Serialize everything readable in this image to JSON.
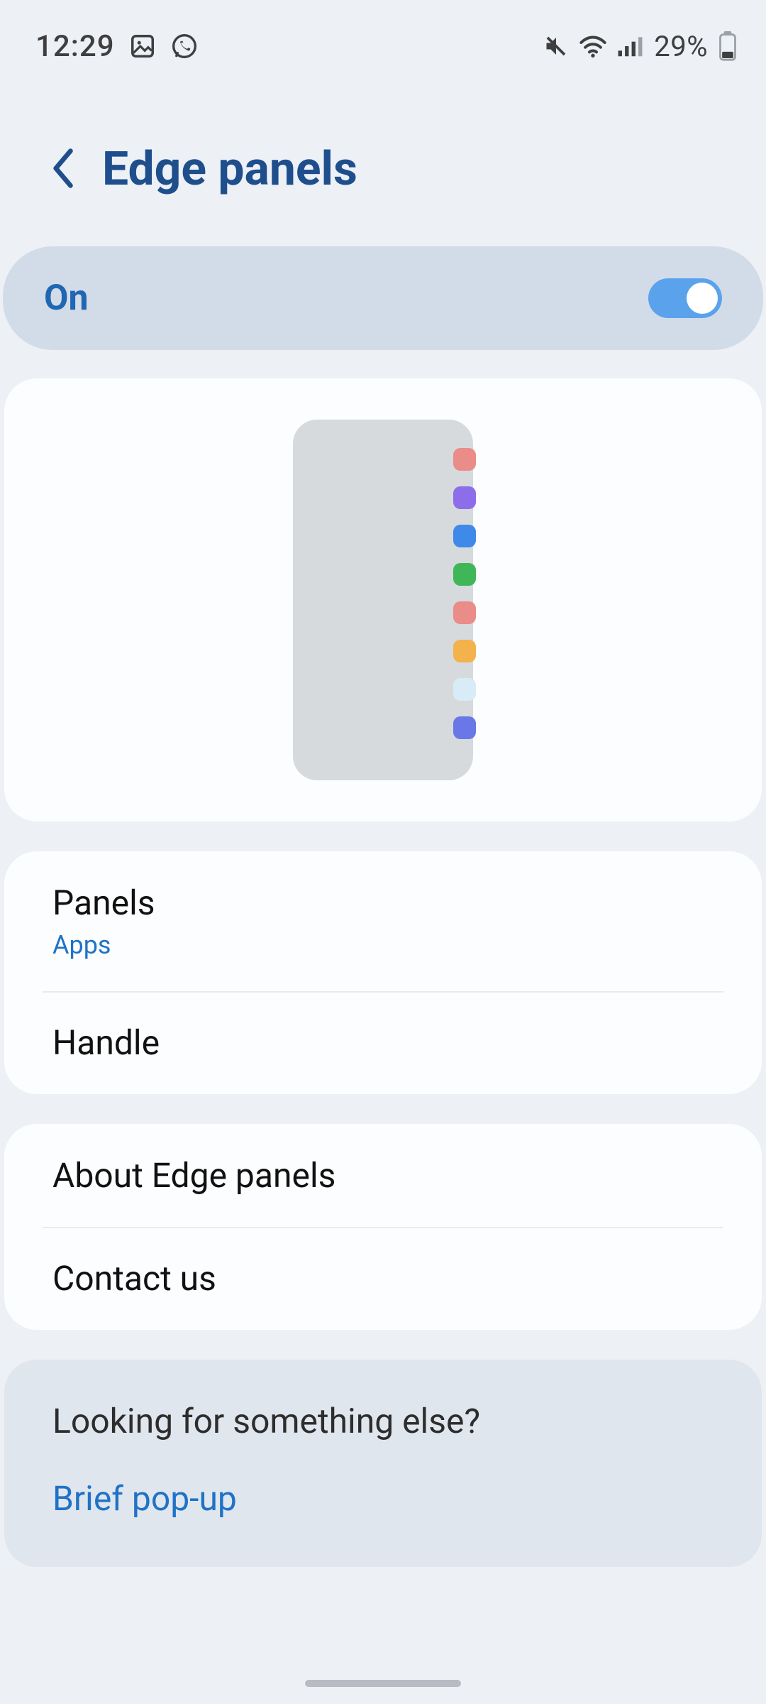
{
  "status": {
    "time": "12:29",
    "battery": "29%"
  },
  "header": {
    "title": "Edge panels"
  },
  "power": {
    "label": "On",
    "enabled": true
  },
  "preview": {
    "dot_colors": [
      "#ea8c88",
      "#8c6eea",
      "#3f8ae8",
      "#3fb759",
      "#ea8c88",
      "#f3b24b",
      "#d8ecf7",
      "#6978e6"
    ]
  },
  "section1": {
    "panels": {
      "title": "Panels",
      "subtitle": "Apps"
    },
    "handle": {
      "title": "Handle"
    }
  },
  "section2": {
    "about": {
      "title": "About Edge panels"
    },
    "contact": {
      "title": "Contact us"
    }
  },
  "suggest": {
    "title": "Looking for something else?",
    "link": "Brief pop-up"
  }
}
